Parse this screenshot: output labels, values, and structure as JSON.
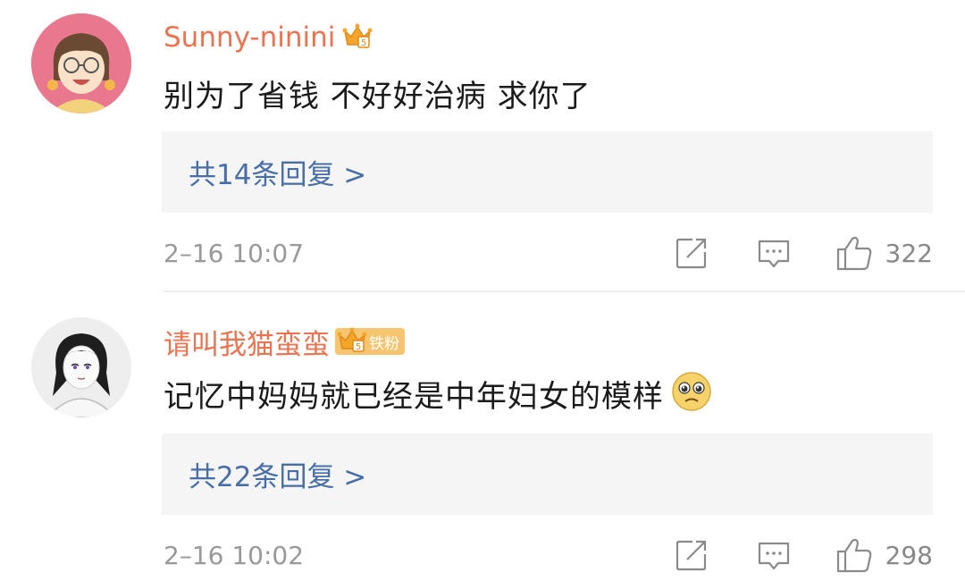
{
  "comments": [
    {
      "username": "Sunny-ninini",
      "text": "别为了省钱 不好好治病 求你了",
      "replies": "共14条回复 >",
      "time": "2–16 10:07",
      "likes": "322",
      "badge_level": "5",
      "badge_icon": "crown-icon"
    },
    {
      "username": "请叫我猫蛮蛮",
      "text": "记忆中妈妈就已经是中年妇女的模样",
      "emoji": "pleading-face-emoji",
      "replies": "共22条回复 >",
      "time": "2–16 10:02",
      "likes": "298",
      "badge_level": "5",
      "badge_icon": "crown-icon",
      "fan_badge": "铁粉"
    }
  ],
  "colors": {
    "username": "#eb7350",
    "reply_link": "#476ea6",
    "reply_bg": "#f5f5f5",
    "meta": "#999999"
  }
}
